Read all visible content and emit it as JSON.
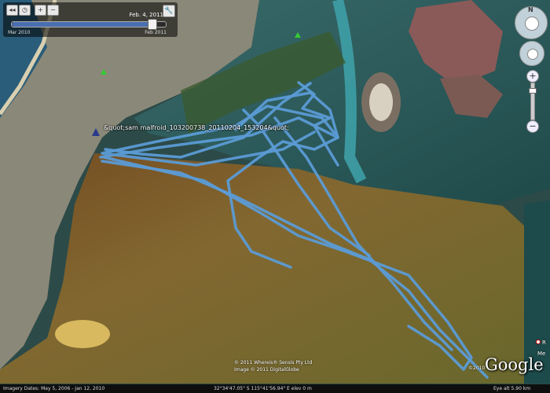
{
  "time_slider": {
    "current_date": "Feb. 4, 2011",
    "start_label": "Mar 2010",
    "end_label": "Feb 2011",
    "position_fraction": 0.91
  },
  "track": {
    "label": "&quot;sam malfroid_103200738_20110204_153204&quot;",
    "color": "#5b9bd5"
  },
  "attribution": {
    "line1": "© 2011 Whereis® Sensis Pty Ltd",
    "line2": "Image © 2011 DigitalGlobe",
    "year": "©2010"
  },
  "branding": {
    "logo_text": "Google"
  },
  "places": {
    "edge_label": "Me",
    "edge_label2": "R"
  },
  "status_bar": {
    "imagery_dates": "Imagery Dates: May 5, 2006 - Jan 12, 2010",
    "coordinates": "32°34'47.05\" S   115°41'56.94\" E  elev  0 m",
    "eye_alt": "Eye alt   5.90 km"
  },
  "navigation": {
    "north_label": "N",
    "zoom_in": "+",
    "zoom_out": "−"
  },
  "icons": {
    "rewind": "rewind-icon",
    "clock": "clock-icon",
    "zoom_in_time": "zoom-in-icon",
    "zoom_out_time": "zoom-out-icon",
    "settings": "wrench-icon"
  }
}
